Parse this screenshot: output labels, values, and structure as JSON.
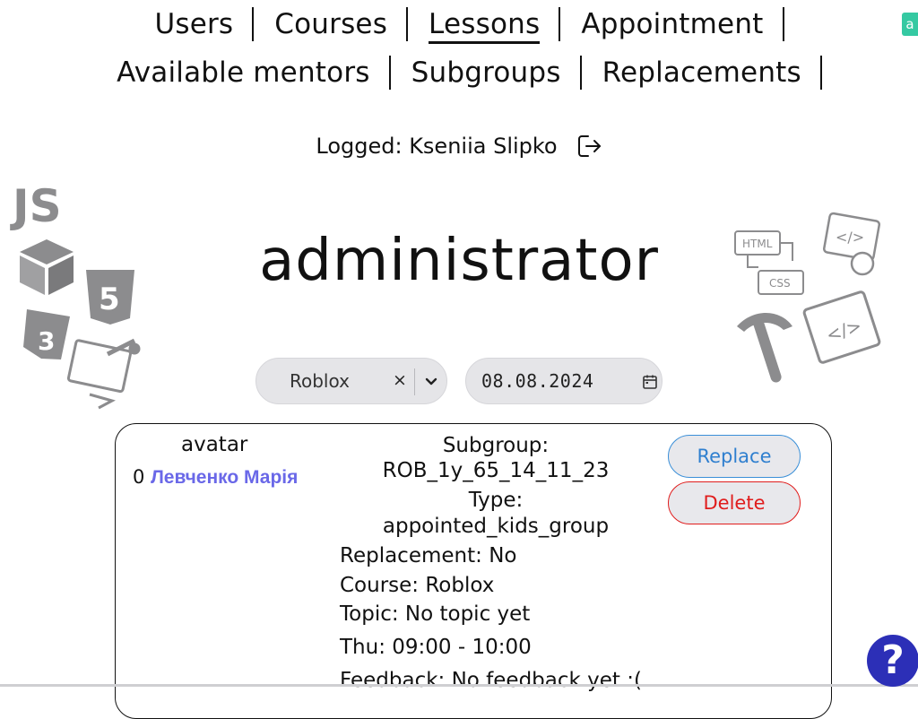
{
  "nav": {
    "row1": [
      "Users",
      "Courses",
      "Lessons",
      "Appointment"
    ],
    "row2": [
      "Available mentors",
      "Subgroups",
      "Replacements"
    ],
    "active": "Lessons"
  },
  "corner_badge": "a",
  "user": {
    "logged_label": "Logged: Kseniia Slipko"
  },
  "role_title": "administrator",
  "filters": {
    "course_select_value": "Roblox",
    "clear_symbol": "×",
    "date_value": "08.08.2024"
  },
  "lesson": {
    "avatar_label": "avatar",
    "student_index": "0",
    "student_name": "Левченко Марія",
    "subgroup_label": "Subgroup:",
    "subgroup_value": "ROB_1y_65_14_11_23",
    "type_label": "Type:",
    "type_value": "appointed_kids_group",
    "replacement": "Replacement: No",
    "course": "Course: Roblox",
    "topic": "Topic: No topic yet",
    "time": "Thu: 09:00 - 10:00",
    "feedback": "Feedback: No feedback yet :("
  },
  "buttons": {
    "replace": "Replace",
    "delete": "Delete"
  },
  "help_symbol": "?",
  "colors": {
    "accent_purple": "#6a68e8",
    "replace_blue": "#2f7fcf",
    "delete_red": "#e01d1d",
    "help_bg": "#2c2fb7",
    "badge_green": "#35c9a2"
  }
}
